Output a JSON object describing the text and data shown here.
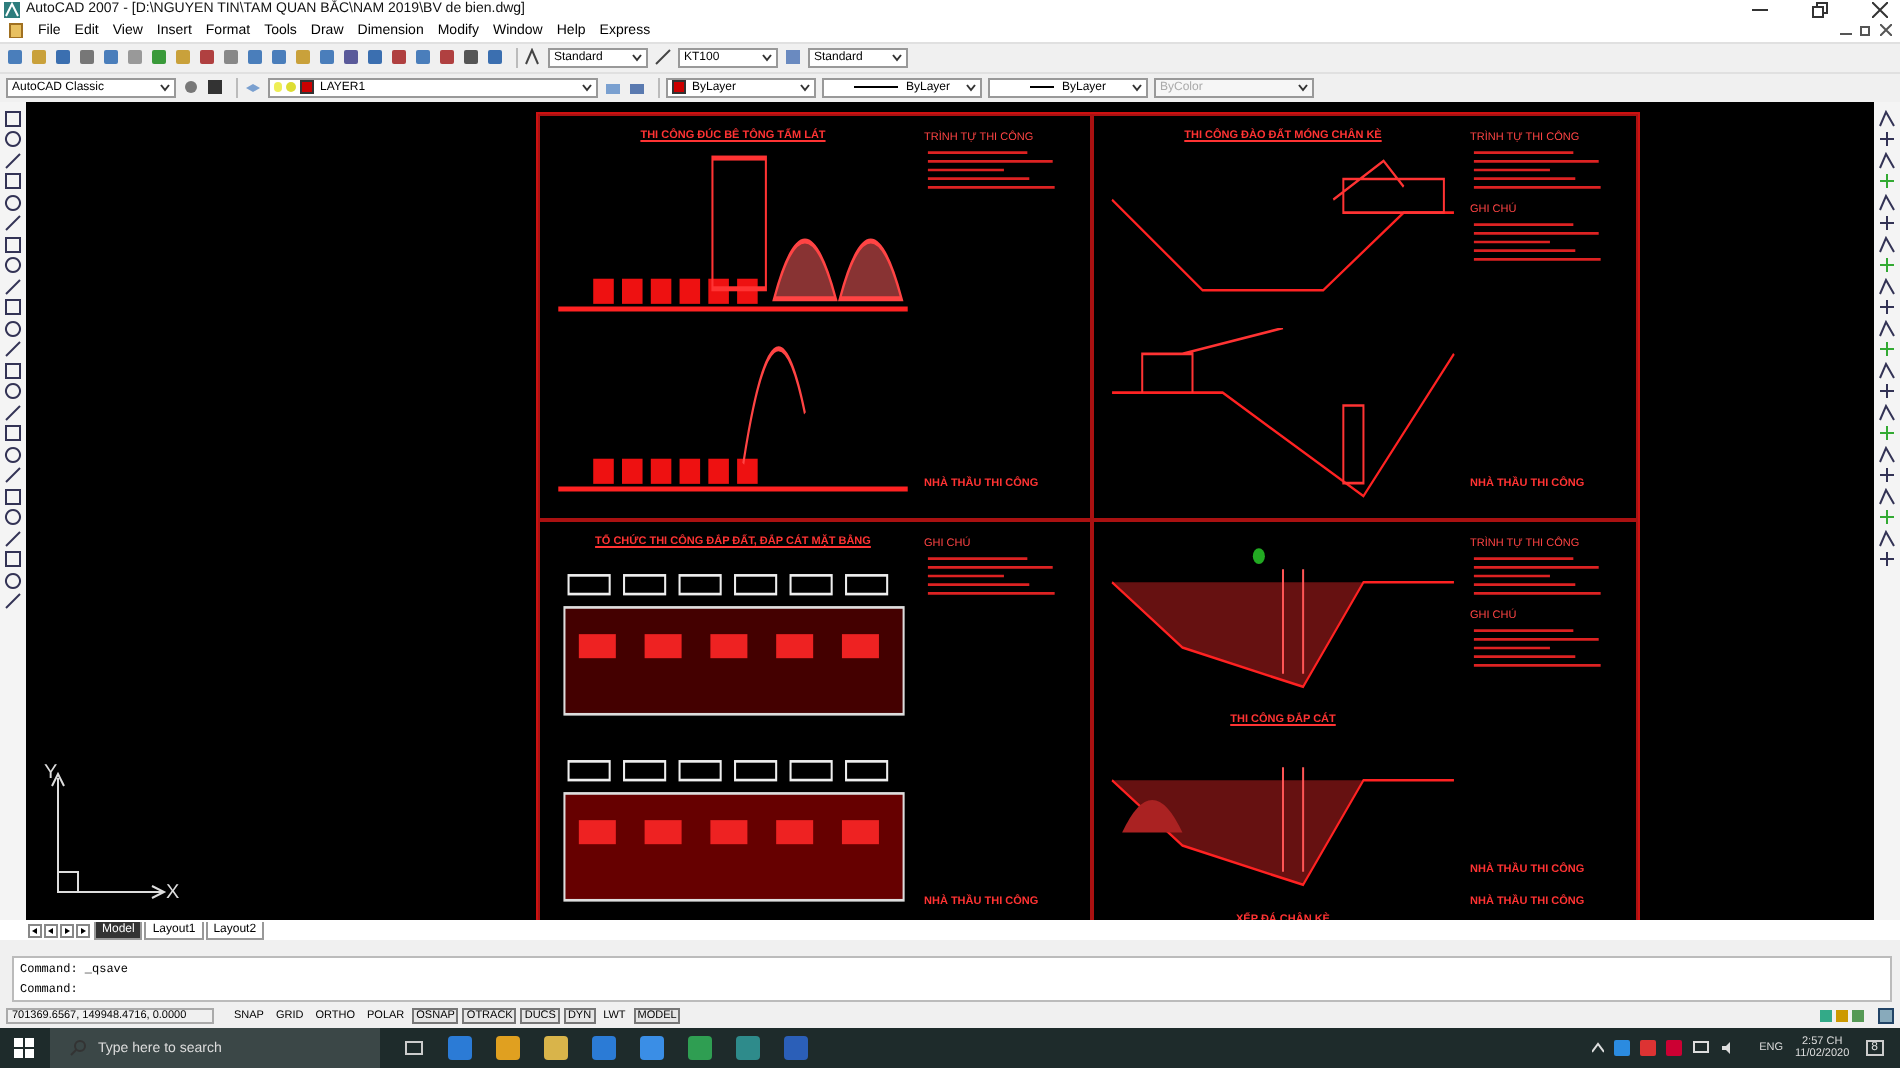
{
  "window": {
    "title": "AutoCAD 2007 - [D:\\NGUYEN TIN\\TAM QUAN BẮC\\NAM 2019\\BV de bien.dwg]"
  },
  "menu": [
    "File",
    "Edit",
    "View",
    "Insert",
    "Format",
    "Tools",
    "Draw",
    "Dimension",
    "Modify",
    "Window",
    "Help",
    "Express"
  ],
  "styles_toolbar": {
    "text_style": "Standard",
    "dim_style": "KT100",
    "table_style": "Standard"
  },
  "properties_bar": {
    "workspace": "AutoCAD Classic",
    "layer": "LAYER1",
    "color_setting": "ByLayer",
    "linetype": "ByLayer",
    "lineweight": "ByLayer",
    "plot_style": "ByColor",
    "plot_style_disabled": true
  },
  "drawing": {
    "panels": [
      {
        "kind": "paving",
        "title": "THI CÔNG ĐÚC BÊ TÔNG TẤM LÁT",
        "notes": [
          "TRÌNH TỰ THI CÔNG"
        ],
        "contractors": [
          "NHÀ THẦU THI CÔNG"
        ]
      },
      {
        "kind": "excavation",
        "title": "THI CÔNG ĐÀO ĐẤT MÓNG CHÂN KÈ",
        "notes": [
          "TRÌNH TỰ THI CÔNG",
          "GHI CHÚ"
        ],
        "contractors": [
          "NHÀ THẦU THI CÔNG"
        ]
      },
      {
        "kind": "embankment",
        "title": "TỔ CHỨC THI CÔNG ĐẮP ĐẤT, ĐẮP CÁT MẶT BẰNG",
        "notes": [
          "GHI CHÚ"
        ],
        "contractors": [
          "NHÀ THẦU THI CÔNG"
        ]
      },
      {
        "kind": "sand-fill",
        "captions": [
          "THI CÔNG ĐẮP CÁT",
          "XẾP ĐÁ CHÂN KÈ"
        ],
        "notes": [
          "TRÌNH TỰ THI CÔNG",
          "GHI CHÚ"
        ],
        "contractors": [
          "NHÀ THẦU THI CÔNG",
          "NHÀ THẦU THI CÔNG"
        ]
      }
    ]
  },
  "ucs": {
    "x_label": "X",
    "y_label": "Y"
  },
  "layout_tabs": [
    {
      "label": "Model",
      "selected": true
    },
    {
      "label": "Layout1",
      "selected": false
    },
    {
      "label": "Layout2",
      "selected": false
    }
  ],
  "command_lines": [
    "Command: _qsave",
    "Command:"
  ],
  "status_bar": {
    "coordinates": "701369.6567, 149948.4716, 0.0000",
    "toggles": [
      {
        "label": "SNAP",
        "on": false
      },
      {
        "label": "GRID",
        "on": false
      },
      {
        "label": "ORTHO",
        "on": false
      },
      {
        "label": "POLAR",
        "on": false
      },
      {
        "label": "OSNAP",
        "on": true
      },
      {
        "label": "OTRACK",
        "on": true
      },
      {
        "label": "DUCS",
        "on": true
      },
      {
        "label": "DYN",
        "on": true
      },
      {
        "label": "LWT",
        "on": false
      },
      {
        "label": "MODEL",
        "on": true
      }
    ]
  },
  "taskbar": {
    "search_placeholder": "Type here to search",
    "language": "ENG",
    "time": "2:57 CH",
    "date": "11/02/2020",
    "notifications": "8"
  }
}
